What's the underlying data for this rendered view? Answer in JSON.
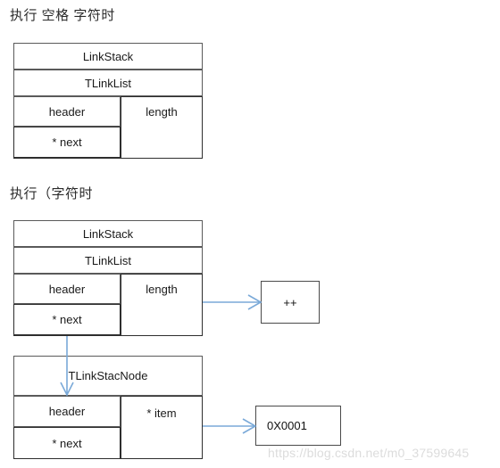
{
  "diagrams": [
    {
      "heading": "执行 空格 字符时",
      "struct": {
        "name": "LinkStack",
        "subname": "TLinkList",
        "left_cells": [
          "header",
          "* next"
        ],
        "right_cells": [
          "length"
        ]
      }
    },
    {
      "heading": "执行（字符时",
      "struct": {
        "name": "LinkStack",
        "subname": "TLinkList",
        "left_cells": [
          "header",
          "* next"
        ],
        "right_cells": [
          "length"
        ]
      },
      "node_struct": {
        "name": "TLinkStacNode",
        "left_cells": [
          "header",
          "* next"
        ],
        "right_cells": [
          "* item"
        ]
      },
      "value_boxes": [
        {
          "label": "++"
        },
        {
          "label": "0X0001"
        }
      ]
    }
  ],
  "connectors": [
    {
      "name": "length-to-increment",
      "from": "length",
      "to": "++"
    },
    {
      "name": "next-to-node",
      "from": "* next",
      "to": "TLinkStacNode"
    },
    {
      "name": "item-to-address",
      "from": "* item",
      "to": "0X0001"
    }
  ],
  "colors": {
    "connector": "#7aa9d8",
    "border_strong": "#2e2e2e",
    "border_soft": "#5a5a5a",
    "text": "#1a1a1a",
    "watermark": "#dcdcdc",
    "background": "#ffffff"
  },
  "watermark": "https://blog.csdn.net/m0_37599645"
}
